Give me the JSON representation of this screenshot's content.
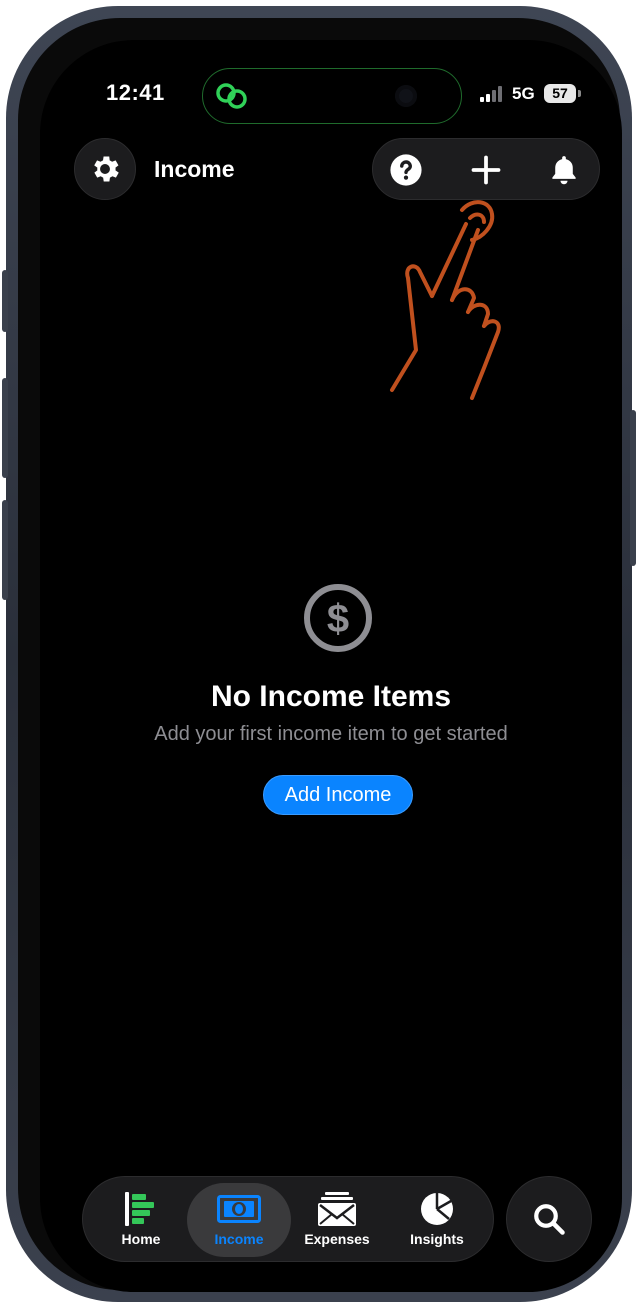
{
  "status_bar": {
    "time": "12:41",
    "network": "5G",
    "battery": "57"
  },
  "header": {
    "title": "Income",
    "settings_icon": "gear-icon",
    "actions": [
      {
        "name": "help-button",
        "icon": "question-circle-icon"
      },
      {
        "name": "add-button",
        "icon": "plus-icon"
      },
      {
        "name": "notifications-button",
        "icon": "bell-icon"
      }
    ]
  },
  "empty_state": {
    "icon": "dollar-circle-icon",
    "title": "No Income Items",
    "subtitle": "Add your first income item to get started",
    "button_label": "Add Income"
  },
  "tab_bar": {
    "tabs": [
      {
        "label": "Home",
        "icon": "home-bars-icon",
        "active": false
      },
      {
        "label": "Income",
        "icon": "banknote-icon",
        "active": true
      },
      {
        "label": "Expenses",
        "icon": "envelope-icon",
        "active": false
      },
      {
        "label": "Insights",
        "icon": "pie-chart-icon",
        "active": false
      }
    ],
    "search_icon": "search-icon"
  },
  "colors": {
    "accent": "#0a84ff",
    "background": "#000000",
    "surface": "#1c1c1e",
    "secondary_text": "#8e8e93",
    "home_icon": "#34c759",
    "annotation_hand": "#c0501e"
  }
}
